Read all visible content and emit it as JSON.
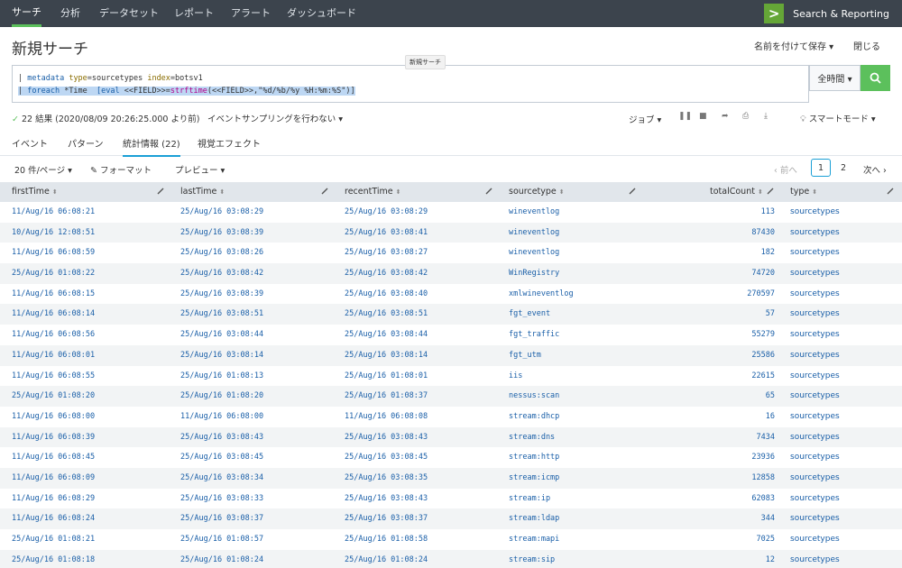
{
  "nav": {
    "tabs": [
      "サーチ",
      "分析",
      "データセット",
      "レポート",
      "アラート",
      "ダッシュボード"
    ],
    "brand": "Search & Reporting"
  },
  "header": {
    "title": "新規サーチ",
    "save_as": "名前を付けて保存 ▾",
    "close": "閉じる"
  },
  "search": {
    "line1_prefix": "| ",
    "line1_cmd": "metadata",
    "line1_arg1k": " type",
    "line1_arg1v": "=sourcetypes ",
    "line1_arg2k": "index",
    "line1_arg2v": "=botsv1",
    "line2_prefix": "| ",
    "line2_cmd": "foreach",
    "line2_mid": " *Time  ",
    "line2_eval": "[eval",
    "line2_field": " <<FIELD>>=",
    "line2_fn": "strftime",
    "line2_rest": "(<<FIELD>>,\"%d/%b/%y %H:%m:%S\")]",
    "tooltip": "新規サーチ",
    "time_range": "全時間 ▾"
  },
  "status": {
    "results": "22 結果 (2020/08/09 20:26:25.000 より前)",
    "sampling": "イベントサンプリングを行わない ▾",
    "job": "ジョブ ▾",
    "smart_mode": "スマートモード ▾"
  },
  "tabs": [
    "イベント",
    "パターン",
    "統計情報 (22)",
    "視覚エフェクト"
  ],
  "toolbar": {
    "per_page": "20 件/ページ ▾",
    "format": "フォーマット",
    "preview": "プレビュー ▾",
    "prev": "‹ 前へ",
    "page1": "1",
    "page2": "2",
    "next": "次へ ›"
  },
  "columns": [
    "firstTime",
    "lastTime",
    "recentTime",
    "sourcetype",
    "totalCount",
    "type"
  ],
  "rows": [
    [
      "11/Aug/16 06:08:21",
      "25/Aug/16 03:08:29",
      "25/Aug/16 03:08:29",
      "wineventlog",
      "113",
      "sourcetypes"
    ],
    [
      "10/Aug/16 12:08:51",
      "25/Aug/16 03:08:39",
      "25/Aug/16 03:08:41",
      "wineventlog",
      "87430",
      "sourcetypes"
    ],
    [
      "11/Aug/16 06:08:59",
      "25/Aug/16 03:08:26",
      "25/Aug/16 03:08:27",
      "wineventlog",
      "182",
      "sourcetypes"
    ],
    [
      "25/Aug/16 01:08:22",
      "25/Aug/16 03:08:42",
      "25/Aug/16 03:08:42",
      "WinRegistry",
      "74720",
      "sourcetypes"
    ],
    [
      "11/Aug/16 06:08:15",
      "25/Aug/16 03:08:39",
      "25/Aug/16 03:08:40",
      "xmlwineventlog",
      "270597",
      "sourcetypes"
    ],
    [
      "11/Aug/16 06:08:14",
      "25/Aug/16 03:08:51",
      "25/Aug/16 03:08:51",
      "fgt_event",
      "57",
      "sourcetypes"
    ],
    [
      "11/Aug/16 06:08:56",
      "25/Aug/16 03:08:44",
      "25/Aug/16 03:08:44",
      "fgt_traffic",
      "55279",
      "sourcetypes"
    ],
    [
      "11/Aug/16 06:08:01",
      "25/Aug/16 03:08:14",
      "25/Aug/16 03:08:14",
      "fgt_utm",
      "25586",
      "sourcetypes"
    ],
    [
      "11/Aug/16 06:08:55",
      "25/Aug/16 01:08:13",
      "25/Aug/16 01:08:01",
      "iis",
      "22615",
      "sourcetypes"
    ],
    [
      "25/Aug/16 01:08:20",
      "25/Aug/16 01:08:20",
      "25/Aug/16 01:08:37",
      "nessus:scan",
      "65",
      "sourcetypes"
    ],
    [
      "11/Aug/16 06:08:00",
      "11/Aug/16 06:08:00",
      "11/Aug/16 06:08:08",
      "stream:dhcp",
      "16",
      "sourcetypes"
    ],
    [
      "11/Aug/16 06:08:39",
      "25/Aug/16 03:08:43",
      "25/Aug/16 03:08:43",
      "stream:dns",
      "7434",
      "sourcetypes"
    ],
    [
      "11/Aug/16 06:08:45",
      "25/Aug/16 03:08:45",
      "25/Aug/16 03:08:45",
      "stream:http",
      "23936",
      "sourcetypes"
    ],
    [
      "11/Aug/16 06:08:09",
      "25/Aug/16 03:08:34",
      "25/Aug/16 03:08:35",
      "stream:icmp",
      "12858",
      "sourcetypes"
    ],
    [
      "11/Aug/16 06:08:29",
      "25/Aug/16 03:08:33",
      "25/Aug/16 03:08:43",
      "stream:ip",
      "62083",
      "sourcetypes"
    ],
    [
      "11/Aug/16 06:08:24",
      "25/Aug/16 03:08:37",
      "25/Aug/16 03:08:37",
      "stream:ldap",
      "344",
      "sourcetypes"
    ],
    [
      "25/Aug/16 01:08:21",
      "25/Aug/16 01:08:57",
      "25/Aug/16 01:08:58",
      "stream:mapi",
      "7025",
      "sourcetypes"
    ],
    [
      "25/Aug/16 01:08:18",
      "25/Aug/16 01:08:24",
      "25/Aug/16 01:08:24",
      "stream:sip",
      "12",
      "sourcetypes"
    ]
  ],
  "colors": {
    "accent": "#5cc05c",
    "link": "#1a5fa8",
    "nav_bg": "#3c444d",
    "tab_active": "#1a9fd6"
  }
}
